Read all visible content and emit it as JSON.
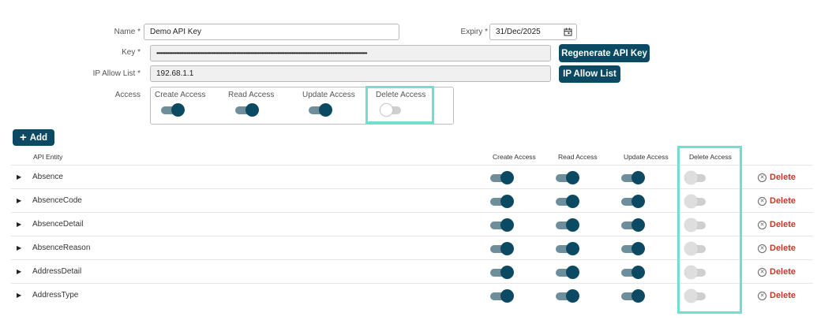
{
  "form": {
    "name_label": "Name *",
    "name_value": "Demo API Key",
    "expiry_label": "Expiry *",
    "expiry_value": "31/Dec/2025",
    "key_label": "Key *",
    "key_value": "••••••••••••••••••••••••••••••••••••••••••••••••••••••••••••••••••••••••••••••••••••••••••••••••••••••••••••••••••••••••••••••••••••••••••••••••••••",
    "regenerate_label": "Regenerate API Key",
    "ip_label": "IP Allow List *",
    "ip_value": "192.68.1.1",
    "ip_button_label": "IP Allow List",
    "access_label": "Access",
    "access": {
      "create_label": "Create Access",
      "read_label": "Read Access",
      "update_label": "Update Access",
      "delete_label": "Delete Access",
      "create": true,
      "read": true,
      "update": true,
      "delete": false
    }
  },
  "add_button_label": "Add",
  "table": {
    "headers": {
      "entity": "API Entity",
      "create": "Create Access",
      "read": "Read Access",
      "update": "Update Access",
      "delete": "Delete Access"
    },
    "delete_action_label": "Delete",
    "rows": [
      {
        "name": "Absence",
        "create": true,
        "read": true,
        "update": true,
        "delete": false
      },
      {
        "name": "AbsenceCode",
        "create": true,
        "read": true,
        "update": true,
        "delete": false
      },
      {
        "name": "AbsenceDetail",
        "create": true,
        "read": true,
        "update": true,
        "delete": false
      },
      {
        "name": "AbsenceReason",
        "create": true,
        "read": true,
        "update": true,
        "delete": false
      },
      {
        "name": "AddressDetail",
        "create": true,
        "read": true,
        "update": true,
        "delete": false
      },
      {
        "name": "AddressType",
        "create": true,
        "read": true,
        "update": true,
        "delete": false
      }
    ]
  },
  "colors": {
    "primary": "#0c4a63",
    "danger": "#c0392b",
    "highlight": "#6fe0d0"
  }
}
